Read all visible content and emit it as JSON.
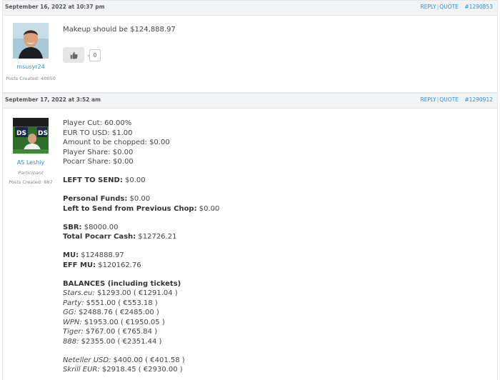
{
  "posts": [
    {
      "date": "September 16, 2022 at 10:37 pm",
      "reply_label": "REPLY",
      "quote_label": "QUOTE",
      "post_number": "#1290853",
      "author": {
        "name": "msusyr24",
        "role": "",
        "posts_created": "Posts Created: 40050"
      },
      "text": "Makeup should be $124,888.97",
      "like_count": "0"
    },
    {
      "date": "September 17, 2022 at 3:52 am",
      "reply_label": "REPLY",
      "quote_label": "QUOTE",
      "post_number": "#1290912",
      "author": {
        "name": "AS Leshiy",
        "role": "Participant",
        "posts_created": "Posts Created: 887"
      },
      "lines": {
        "player_cut": "Player Cut: 60.00%",
        "eur_to_usd": "EUR TO USD: $1.00",
        "amount_chopped": "Amount to be chopped: $0.00",
        "player_share": "Player Share: $0.00",
        "pocarr_share": "Pocarr Share: $0.00",
        "left_to_send_label": "LEFT TO SEND:",
        "left_to_send_value": " $0.00",
        "personal_funds_label": "Personal Funds:",
        "personal_funds_value": " $0.00",
        "left_prev_chop_label": "Left to Send from Previous Chop:",
        "left_prev_chop_value": " $0.00",
        "sbr_label": "SBR:",
        "sbr_value": " $8000.00",
        "total_pocarr_label": "Total Pocarr Cash:",
        "total_pocarr_value": " $12726.21",
        "mu_label": "MU:",
        "mu_value": " $124888.97",
        "eff_mu_label": "EFF MU:",
        "eff_mu_value": " $120162.76",
        "balances_heading": "BALANCES (including tickets)"
      },
      "balances": [
        {
          "site": "Stars.eu:",
          "value": " $1293.00 ( €1291.04 )"
        },
        {
          "site": "Party:",
          "value": " $551.00 ( €553.18 )"
        },
        {
          "site": "GG:",
          "value": " $2488.76 ( €2485.00 )"
        },
        {
          "site": "WPN:",
          "value": " $1953.00 ( €1950.05 )"
        },
        {
          "site": "Tiger:",
          "value": " $767.00 ( €765.84 )"
        },
        {
          "site": "888:",
          "value": " $2355.00 ( €2351.44 )"
        }
      ],
      "wallets": [
        {
          "site": "Neteller USD:",
          "value": " $400.00 ( €401.58 )"
        },
        {
          "site": "Skrill EUR:",
          "value": " $2918.45 ( €2930.00 )"
        }
      ]
    }
  ]
}
